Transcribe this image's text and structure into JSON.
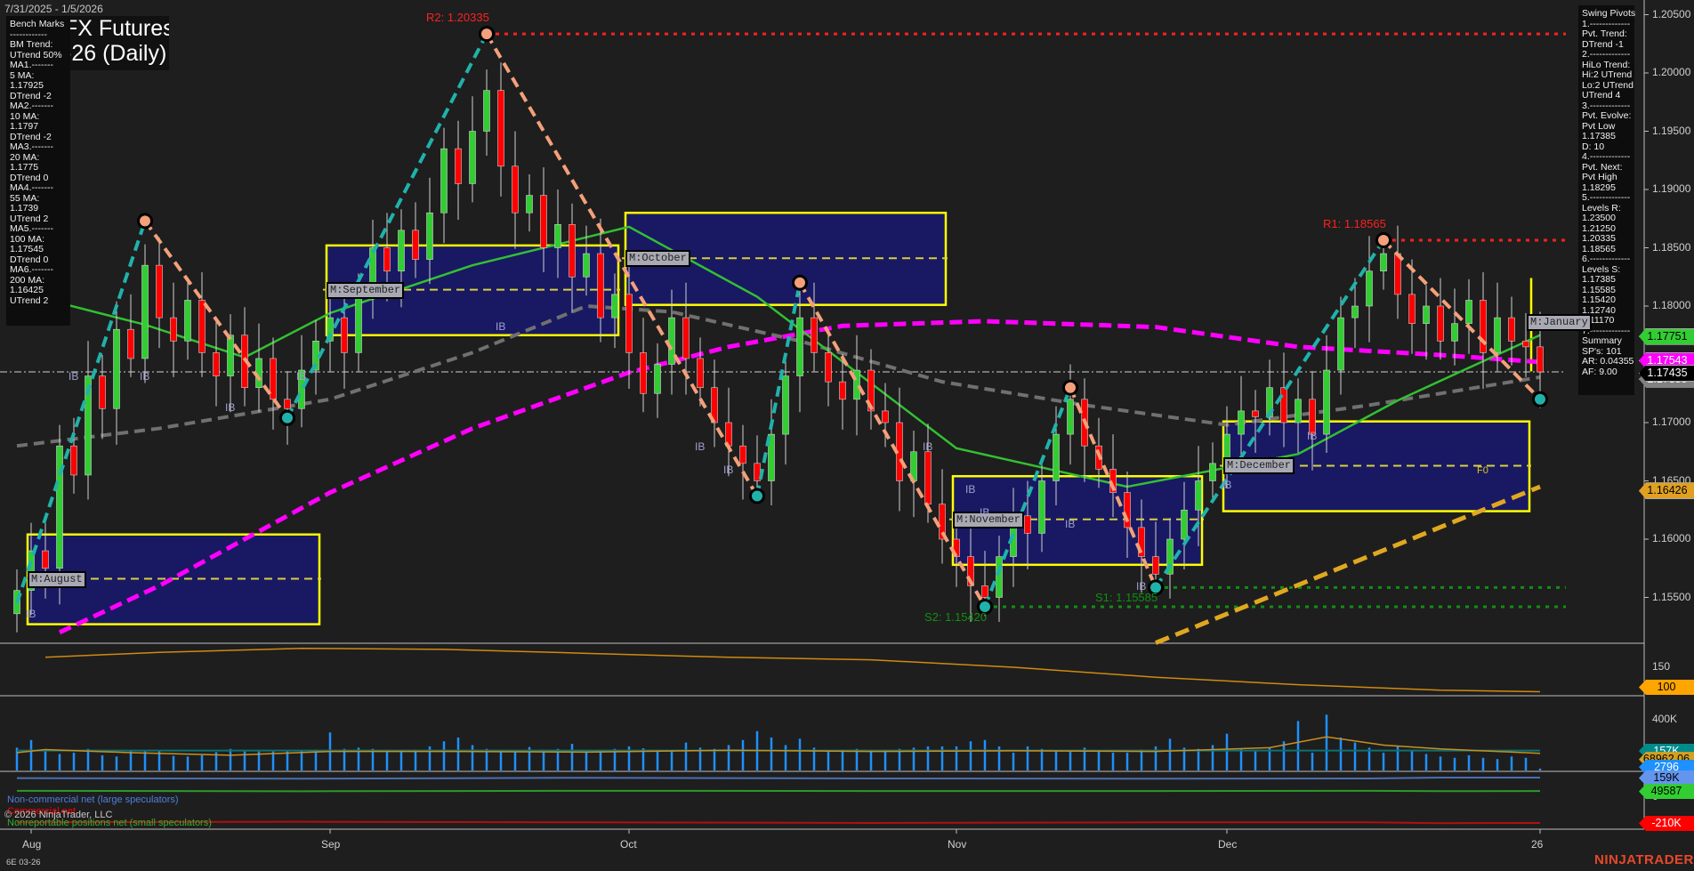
{
  "header": {
    "date_range": "7/31/2025 - 1/5/2026",
    "title_line1": "FX Futures",
    "title_line2": "-26 (Daily)",
    "instrument": "6E 03-26"
  },
  "left_panel": {
    "lines": [
      "Bench Marks",
      "------------",
      "BM Trend:",
      "UTrend 50%",
      "MA1.-------",
      "5 MA:",
      "1.17925",
      "DTrend -2",
      "MA2.-------",
      "10 MA:",
      "1.1797",
      "DTrend -2",
      "MA3.-------",
      "20 MA:",
      "1.1775",
      "DTrend 0",
      "MA4.-------",
      "55 MA:",
      "1.1739",
      "UTrend 2",
      "MA5.-------",
      "100 MA:",
      "1.17545",
      "DTrend 0",
      "MA6.-------",
      "200 MA:",
      "1.16425",
      "UTrend 2"
    ]
  },
  "right_panel": {
    "lines": [
      "Swing Pivots",
      "1.-------------",
      "Pvt. Trend:",
      "DTrend -1",
      "2.-------------",
      "HiLo Trend:",
      "Hi:2 UTrend",
      "Lo:2 UTrend",
      "UTrend 4",
      "3.-------------",
      "Pvt. Evolve:",
      "Pvt Low",
      "1.17385",
      "D: 10",
      "4.-------------",
      "Pvt. Next:",
      "Pvt High",
      "1.18295",
      "5.-------------",
      "Levels R:",
      "1.23500",
      "1.21250",
      "1.20335",
      "1.18565",
      "6.-------------",
      "Levels S:",
      "1.17385",
      "1.15585",
      "1.15420",
      "1.12740",
      "1.11170",
      "7.-------------",
      "Summary",
      "SP's: 101",
      "AR: 0.04355",
      "AF: 9.00"
    ]
  },
  "footer": {
    "copyright": "© 2026 NinjaTrader, LLC",
    "logo": "NINJATRADER"
  },
  "legend": {
    "noncommercial": "Non-commercial net (large speculators)",
    "commercial": "Commercial net",
    "nonreportable": "Nonreportable positions net (small speculators)"
  },
  "colors": {
    "up": "#32cd32",
    "down": "#ff0000",
    "ma20": "#32c032",
    "ma55": "#707070",
    "ma200": "#ff00ff",
    "swing_up": "#20b2aa",
    "swing_down": "#f4a07a",
    "box_border": "#ffff00",
    "box_fill": "#191970",
    "trend": "#e0a820"
  },
  "chart_data": {
    "type": "candlestick",
    "title": "FX Futures -26 (Daily)",
    "ylim": [
      1.148,
      1.2075
    ],
    "y_ticks": [
      "1.20500",
      "1.20000",
      "1.19500",
      "1.19000",
      "1.18500",
      "1.18000",
      "1.17500",
      "1.17000",
      "1.16500",
      "1.16000",
      "1.15500"
    ],
    "y_tick_values": [
      1.205,
      1.2,
      1.195,
      1.19,
      1.185,
      1.18,
      1.175,
      1.17,
      1.165,
      1.16,
      1.155
    ],
    "x_ticks": [
      {
        "label": "Aug",
        "bar": 1
      },
      {
        "label": "Sep",
        "bar": 22
      },
      {
        "label": "Oct",
        "bar": 43
      },
      {
        "label": "Nov",
        "bar": 66
      },
      {
        "label": "Dec",
        "bar": 85
      },
      {
        "label": "26",
        "bar": 107
      }
    ],
    "closes": [
      1.1556,
      1.159,
      1.1575,
      1.168,
      1.1655,
      1.174,
      1.1712,
      1.178,
      1.1755,
      1.1835,
      1.179,
      1.177,
      1.1805,
      1.176,
      1.174,
      1.1775,
      1.173,
      1.1755,
      1.172,
      1.1712,
      1.1745,
      1.177,
      1.179,
      1.176,
      1.181,
      1.185,
      1.183,
      1.1865,
      1.184,
      1.188,
      1.1935,
      1.1905,
      1.195,
      1.1985,
      1.192,
      1.188,
      1.1895,
      1.185,
      1.187,
      1.1825,
      1.1845,
      1.179,
      1.181,
      1.176,
      1.1725,
      1.175,
      1.179,
      1.1755,
      1.173,
      1.17,
      1.168,
      1.1665,
      1.165,
      1.169,
      1.174,
      1.179,
      1.176,
      1.1735,
      1.172,
      1.1745,
      1.171,
      1.17,
      1.165,
      1.1675,
      1.163,
      1.16,
      1.1585,
      1.156,
      1.155,
      1.1585,
      1.162,
      1.1605,
      1.165,
      1.169,
      1.172,
      1.168,
      1.166,
      1.164,
      1.161,
      1.1585,
      1.157,
      1.16,
      1.1625,
      1.165,
      1.1665,
      1.169,
      1.171,
      1.1705,
      1.173,
      1.17,
      1.172,
      1.169,
      1.1745,
      1.179,
      1.18,
      1.183,
      1.1845,
      1.181,
      1.1785,
      1.18,
      1.177,
      1.1785,
      1.1805,
      1.176,
      1.179,
      1.177,
      1.1765,
      1.17435
    ],
    "swing_pivots": [
      [
        0,
        1.1545
      ],
      [
        9,
        1.1873
      ],
      [
        19,
        1.1704
      ],
      [
        33,
        1.20335
      ],
      [
        52,
        1.1637
      ],
      [
        55,
        1.182
      ],
      [
        68,
        1.1542
      ],
      [
        74,
        1.173
      ],
      [
        80,
        1.15585
      ],
      [
        96,
        1.18565
      ],
      [
        107,
        1.172
      ]
    ],
    "ma20": [
      [
        0,
        1.1812
      ],
      [
        9,
        1.1784
      ],
      [
        16,
        1.1756
      ],
      [
        22,
        1.1794
      ],
      [
        32,
        1.1835
      ],
      [
        43,
        1.1868
      ],
      [
        52,
        1.1808
      ],
      [
        66,
        1.1678
      ],
      [
        78,
        1.1645
      ],
      [
        90,
        1.1673
      ],
      [
        97,
        1.1719
      ],
      [
        107,
        1.17751
      ]
    ],
    "ma55": [
      [
        0,
        1.168
      ],
      [
        10,
        1.1695
      ],
      [
        22,
        1.172
      ],
      [
        32,
        1.176
      ],
      [
        40,
        1.18
      ],
      [
        46,
        1.1795
      ],
      [
        55,
        1.177
      ],
      [
        65,
        1.1735
      ],
      [
        75,
        1.1715
      ],
      [
        85,
        1.1698
      ],
      [
        95,
        1.1715
      ],
      [
        107,
        1.1739
      ]
    ],
    "ma200": [
      [
        3,
        1.152
      ],
      [
        10,
        1.156
      ],
      [
        22,
        1.164
      ],
      [
        32,
        1.1695
      ],
      [
        43,
        1.1743
      ],
      [
        50,
        1.1765
      ],
      [
        58,
        1.1783
      ],
      [
        68,
        1.1787
      ],
      [
        80,
        1.1782
      ],
      [
        90,
        1.1765
      ],
      [
        100,
        1.1758
      ],
      [
        107,
        1.1752
      ]
    ],
    "trendline": [
      [
        80,
        1.1511
      ],
      [
        107,
        1.1645
      ]
    ],
    "levels": [
      {
        "label": "R2: 1.20335",
        "value": 1.20335,
        "from": 33,
        "color": "#ff2020"
      },
      {
        "label": "R1: 1.18565",
        "value": 1.18565,
        "from": 96,
        "color": "#ff2020"
      },
      {
        "label": "S1: 1.15585",
        "value": 1.15585,
        "from": 80,
        "color": "#109010"
      },
      {
        "label": "S2: 1.15420",
        "value": 1.1542,
        "from": 68,
        "color": "#109010"
      }
    ],
    "last_price_line": 1.17435,
    "monthly_boxes": [
      {
        "label": "M:August",
        "from": 1,
        "to": 21,
        "high": 1.1604,
        "low": 1.1527,
        "mid": 1.1566
      },
      {
        "label": "M:September",
        "from": 22,
        "to": 42,
        "high": 1.1852,
        "low": 1.1775,
        "mid": 1.1814
      },
      {
        "label": "M:October",
        "from": 43,
        "to": 65,
        "high": 1.188,
        "low": 1.1801,
        "mid": 1.1841
      },
      {
        "label": "M:November",
        "from": 66,
        "to": 83,
        "high": 1.1654,
        "low": 1.1578,
        "mid": 1.1617
      },
      {
        "label": "M:December",
        "from": 85,
        "to": 106,
        "high": 1.1701,
        "low": 1.1624,
        "mid": 1.1663
      }
    ],
    "january_label": "M:January",
    "f0_label": "F0",
    "ib_labels": [
      [
        4,
        1.1745
      ],
      [
        9,
        1.1745
      ],
      [
        15,
        1.1718
      ],
      [
        20,
        1.1745
      ],
      [
        34,
        1.1788
      ],
      [
        48,
        1.1685
      ],
      [
        50,
        1.1665
      ],
      [
        64,
        1.1685
      ],
      [
        67,
        1.1648
      ],
      [
        68,
        1.1628
      ],
      [
        74,
        1.1618
      ],
      [
        79,
        1.1565
      ],
      [
        91,
        1.1694
      ],
      [
        85,
        1.1652
      ],
      [
        1,
        1.1541
      ]
    ],
    "price_tags": [
      {
        "label": "1.17751",
        "value": 1.17751,
        "bg": "#32cd32",
        "fg": "#000"
      },
      {
        "label": "1.17543",
        "value": 1.17543,
        "bg": "#ff00ff",
        "fg": "#fff"
      },
      {
        "label": "1.17385",
        "value": 1.17385,
        "bg": "#808080",
        "fg": "#fff"
      },
      {
        "label": "1.17435",
        "value": 1.17435,
        "bg": "#000000",
        "fg": "#fff"
      },
      {
        "label": "1.16426",
        "value": 1.16426,
        "bg": "#e0a020",
        "fg": "#000"
      }
    ],
    "indicator": {
      "ticks": [
        "150"
      ],
      "tick_values": [
        150
      ],
      "series": [
        [
          2,
          170
        ],
        [
          10,
          180
        ],
        [
          20,
          188
        ],
        [
          30,
          186
        ],
        [
          40,
          178
        ],
        [
          50,
          170
        ],
        [
          60,
          165
        ],
        [
          70,
          150
        ],
        [
          80,
          130
        ],
        [
          90,
          115
        ],
        [
          100,
          104
        ],
        [
          107,
          101
        ]
      ],
      "tag": "100"
    },
    "volume": {
      "ticks": [
        "400K"
      ],
      "tick_values": [
        400
      ],
      "values": [
        180,
        240,
        150,
        130,
        140,
        170,
        120,
        110,
        160,
        150,
        155,
        115,
        110,
        120,
        145,
        170,
        150,
        150,
        150,
        150,
        160,
        165,
        300,
        170,
        180,
        170,
        160,
        150,
        165,
        190,
        230,
        260,
        200,
        170,
        155,
        150,
        185,
        165,
        170,
        210,
        150,
        160,
        170,
        190,
        175,
        150,
        160,
        220,
        180,
        170,
        200,
        240,
        310,
        260,
        200,
        250,
        180,
        150,
        155,
        170,
        160,
        150,
        170,
        180,
        190,
        190,
        190,
        230,
        240,
        190,
        140,
        190,
        170,
        160,
        150,
        180,
        150,
        140,
        140,
        165,
        190,
        250,
        180,
        170,
        200,
        290,
        170,
        150,
        180,
        230,
        390,
        140,
        440,
        260,
        220,
        180,
        140,
        190,
        160,
        130,
        110,
        100,
        120,
        100,
        90,
        110,
        100,
        15
      ],
      "avg": [
        [
          0,
          140
        ],
        [
          2,
          165
        ],
        [
          8,
          140
        ],
        [
          15,
          120
        ],
        [
          22,
          150
        ],
        [
          30,
          150
        ],
        [
          40,
          145
        ],
        [
          50,
          160
        ],
        [
          60,
          150
        ],
        [
          70,
          155
        ],
        [
          80,
          150
        ],
        [
          88,
          180
        ],
        [
          92,
          265
        ],
        [
          96,
          200
        ],
        [
          100,
          170
        ],
        [
          104,
          150
        ],
        [
          107,
          135
        ]
      ],
      "oi_level": 157,
      "tags": [
        {
          "label": "157K",
          "bg": "#008b8b",
          "fg": "#fff",
          "value": 157
        },
        {
          "label": "68962.06",
          "bg": "#d4a020",
          "fg": "#000",
          "value": 90
        },
        {
          "label": "2796",
          "bg": "#1e90ff",
          "fg": "#fff",
          "value": 30
        }
      ]
    },
    "cot": {
      "noncommercial": [
        [
          0,
          155
        ],
        [
          20,
          150
        ],
        [
          40,
          158
        ],
        [
          60,
          152
        ],
        [
          80,
          150
        ],
        [
          95,
          152
        ],
        [
          100,
          159
        ],
        [
          107,
          159
        ]
      ],
      "nonreportable": [
        [
          0,
          52
        ],
        [
          20,
          48
        ],
        [
          40,
          52
        ],
        [
          60,
          50
        ],
        [
          80,
          50
        ],
        [
          95,
          52
        ],
        [
          100,
          49
        ],
        [
          107,
          49.587
        ]
      ],
      "commercial": [
        [
          0,
          -205
        ],
        [
          20,
          -200
        ],
        [
          40,
          -205
        ],
        [
          60,
          -210
        ],
        [
          80,
          -205
        ],
        [
          95,
          -205
        ],
        [
          100,
          -212
        ],
        [
          107,
          -210
        ]
      ],
      "zero_label": "0",
      "tags": [
        {
          "label": "159K",
          "bg": "#6495ed",
          "fg": "#000",
          "value": 159
        },
        {
          "label": "49587",
          "bg": "#32cd32",
          "fg": "#000",
          "value": 49.587
        },
        {
          "label": "-210K",
          "bg": "#ff0000",
          "fg": "#fff",
          "value": -210
        }
      ]
    }
  }
}
